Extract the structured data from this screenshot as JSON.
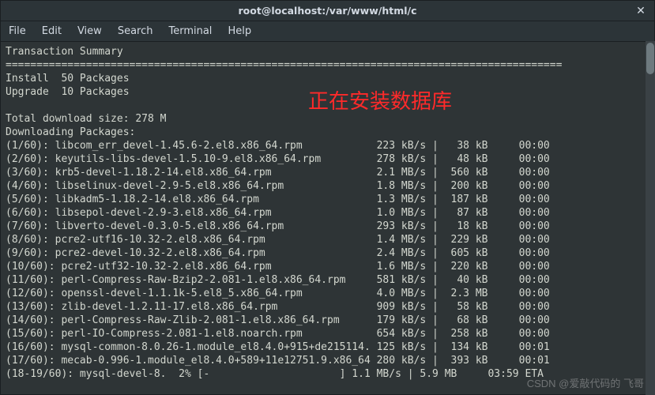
{
  "titlebar": {
    "title": "root@localhost:/var/www/html/c",
    "close_glyph": "✕"
  },
  "menubar": {
    "items": [
      "File",
      "Edit",
      "View",
      "Search",
      "Terminal",
      "Help"
    ]
  },
  "overlay": {
    "text": "正在安装数据库"
  },
  "watermark": {
    "text": "CSDN @爱敲代码的 飞哥"
  },
  "terminal": {
    "header": {
      "summary_title": "Transaction Summary",
      "divider": "==========================================================================================",
      "install_line": "Install  50 Packages",
      "upgrade_line": "Upgrade  10 Packages",
      "blank": "",
      "total_dl": "Total download size: 278 M",
      "dl_title": "Downloading Packages:"
    },
    "rows": [
      {
        "idx": "(1/60):",
        "pkg": "libcom_err_devel-1.45.6-2.el8.x86_64.rpm",
        "pad": 12,
        "speed": "223 kB/s",
        "size": "  38 kB",
        "time": "00:00"
      },
      {
        "idx": "(2/60):",
        "pkg": "keyutils-libs-devel-1.5.10-9.el8.x86_64.rpm",
        "pad": 9,
        "speed": "278 kB/s",
        "size": "  48 kB",
        "time": "00:00"
      },
      {
        "idx": "(3/60):",
        "pkg": "krb5-devel-1.18.2-14.el8.x86_64.rpm",
        "pad": 17,
        "speed": "2.1 MB/s",
        "size": " 560 kB",
        "time": "00:00"
      },
      {
        "idx": "(4/60):",
        "pkg": "libselinux-devel-2.9-5.el8.x86_64.rpm",
        "pad": 15,
        "speed": "1.8 MB/s",
        "size": " 200 kB",
        "time": "00:00"
      },
      {
        "idx": "(5/60):",
        "pkg": "libkadm5-1.18.2-14.el8.x86_64.rpm",
        "pad": 19,
        "speed": "1.3 MB/s",
        "size": " 187 kB",
        "time": "00:00"
      },
      {
        "idx": "(6/60):",
        "pkg": "libsepol-devel-2.9-3.el8.x86_64.rpm",
        "pad": 17,
        "speed": "1.0 MB/s",
        "size": "  87 kB",
        "time": "00:00"
      },
      {
        "idx": "(7/60):",
        "pkg": "libverto-devel-0.3.0-5.el8.x86_64.rpm",
        "pad": 15,
        "speed": "293 kB/s",
        "size": "  18 kB",
        "time": "00:00"
      },
      {
        "idx": "(8/60):",
        "pkg": "pcre2-utf16-10.32-2.el8.x86_64.rpm",
        "pad": 18,
        "speed": "1.4 MB/s",
        "size": " 229 kB",
        "time": "00:00"
      },
      {
        "idx": "(9/60):",
        "pkg": "pcre2-devel-10.32-2.el8.x86_64.rpm",
        "pad": 18,
        "speed": "2.4 MB/s",
        "size": " 605 kB",
        "time": "00:00"
      },
      {
        "idx": "(10/60):",
        "pkg": "pcre2-utf32-10.32-2.el8.x86_64.rpm",
        "pad": 17,
        "speed": "1.6 MB/s",
        "size": " 220 kB",
        "time": "00:00"
      },
      {
        "idx": "(11/60):",
        "pkg": "perl-Compress-Raw-Bzip2-2.081-1.el8.x86_64.rpm",
        "pad": 5,
        "speed": "581 kB/s",
        "size": "  40 kB",
        "time": "00:00"
      },
      {
        "idx": "(12/60):",
        "pkg": "openssl-devel-1.1.1k-5.el8_5.x86_64.rpm",
        "pad": 12,
        "speed": "4.0 MB/s",
        "size": " 2.3 MB",
        "time": "00:00"
      },
      {
        "idx": "(13/60):",
        "pkg": "zlib-devel-1.2.11-17.el8.x86_64.rpm",
        "pad": 16,
        "speed": "909 kB/s",
        "size": "  58 kB",
        "time": "00:00"
      },
      {
        "idx": "(14/60):",
        "pkg": "perl-Compress-Raw-Zlib-2.081-1.el8.x86_64.rpm",
        "pad": 6,
        "speed": "179 kB/s",
        "size": "  68 kB",
        "time": "00:00"
      },
      {
        "idx": "(15/60):",
        "pkg": "perl-IO-Compress-2.081-1.el8.noarch.rpm",
        "pad": 12,
        "speed": "654 kB/s",
        "size": " 258 kB",
        "time": "00:00"
      },
      {
        "idx": "(16/60):",
        "pkg": "mysql-common-8.0.26-1.module_el8.4.0+915+de215114.",
        "pad": 1,
        "speed": "125 kB/s",
        "size": " 134 kB",
        "time": "00:01"
      },
      {
        "idx": "(17/60):",
        "pkg": "mecab-0.996-1.module_el8.4.0+589+11e12751.9.x86_64",
        "pad": 1,
        "speed": "280 kB/s",
        "size": " 393 kB",
        "time": "00:01"
      }
    ],
    "progress": {
      "line": "(18-19/60): mysql-devel-8.  2% [-                     ] 1.1 MB/s | 5.9 MB     03:59 ETA"
    }
  }
}
